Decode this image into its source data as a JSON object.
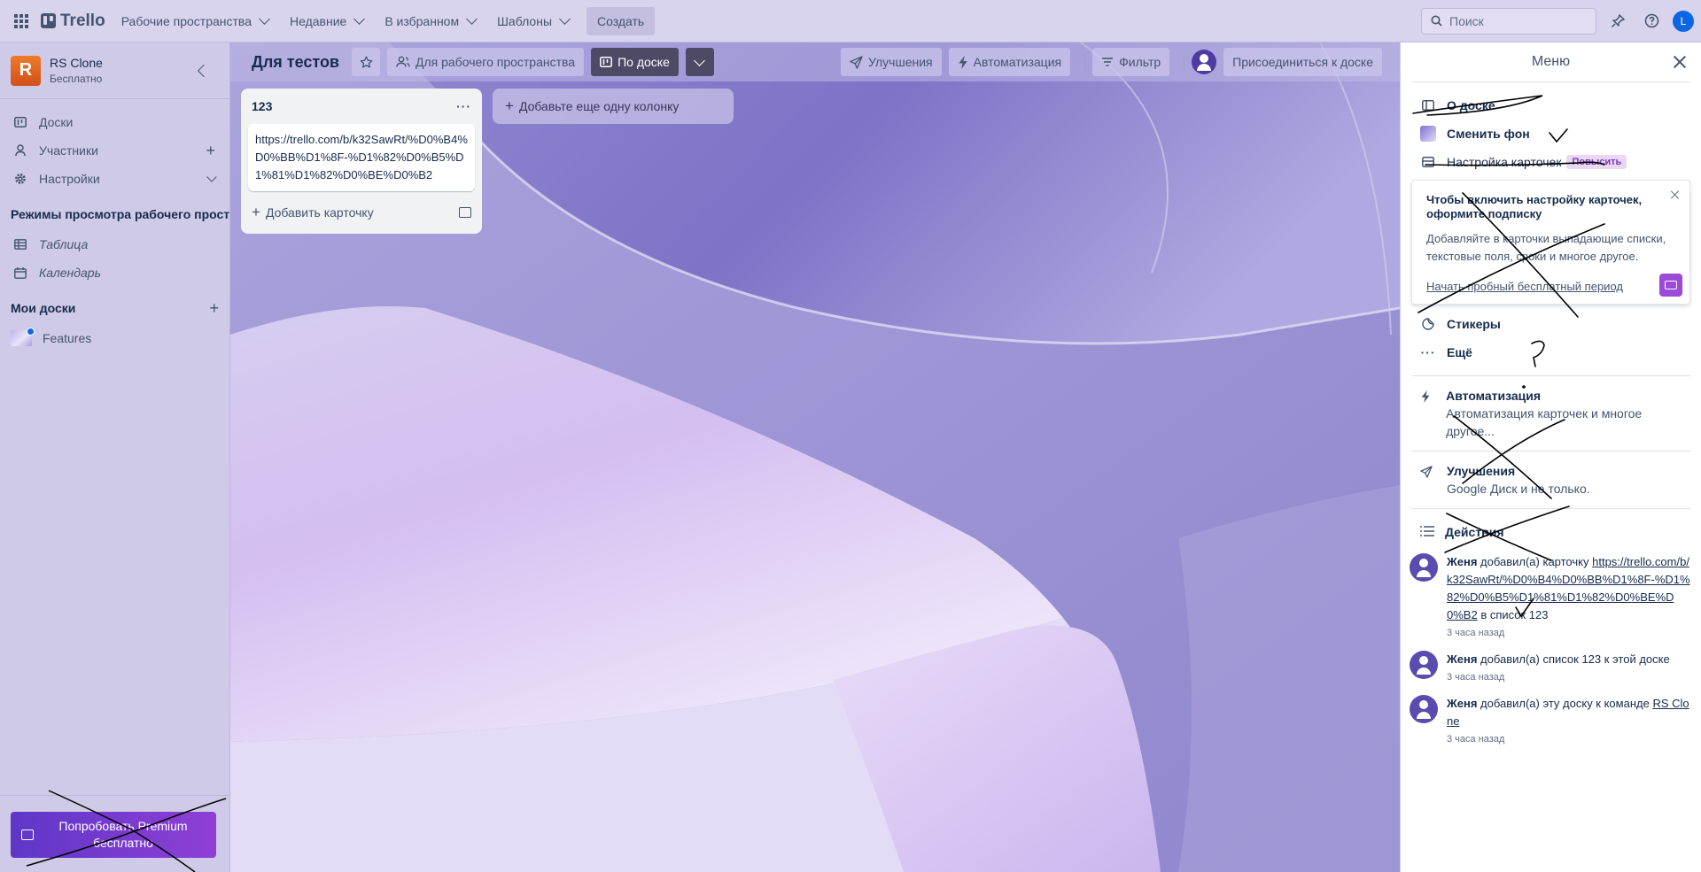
{
  "topbar": {
    "logo": "Trello",
    "nav": [
      {
        "label": "Рабочие пространства"
      },
      {
        "label": "Недавние"
      },
      {
        "label": "В избранном"
      },
      {
        "label": "Шаблоны"
      }
    ],
    "create": "Создать",
    "search_placeholder": "Поиск",
    "avatar_letter": "L"
  },
  "sidebar": {
    "workspace_letter": "R",
    "workspace_name": "RS Clone",
    "workspace_plan": "Бесплатно",
    "items": [
      {
        "label": "Доски"
      },
      {
        "label": "Участники"
      },
      {
        "label": "Настройки"
      }
    ],
    "views_header": "Режимы просмотра рабочего пространства",
    "views": [
      {
        "label": "Таблица"
      },
      {
        "label": "Календарь"
      }
    ],
    "my_boards_header": "Мои доски",
    "boards": [
      {
        "label": "Features"
      }
    ],
    "premium": "Попробовать Premium бесплатно"
  },
  "board": {
    "title": "Для тестов",
    "visibility": "Для рабочего пространства",
    "view": "По доске",
    "powerups": "Улучшения",
    "automation": "Автоматизация",
    "filter": "Фильтр",
    "join": "Присоединиться к доске",
    "lists": [
      {
        "title": "123",
        "cards": [
          {
            "text": "https://trello.com/b/k32SawRt/%D0%B4%D0%BB%D1%8F-%D1%82%D0%B5%D1%81%D1%82%D0%BE%D0%B2"
          }
        ],
        "add_card": "Добавить карточку"
      }
    ],
    "add_list": "Добавьте еще одну колонку"
  },
  "menu": {
    "title": "Меню",
    "about": "О доске",
    "change_bg": "Сменить фон",
    "card_settings": "Настройка карточек",
    "upgrade": "Повысить",
    "promo": {
      "title": "Чтобы включить настройку карточек, оформите подписку",
      "text": "Добавляйте в карточки выпадающие списки, текстовые поля, сроки и многое другое.",
      "link": "Начать пробный бесплатный период"
    },
    "stickers": "Стикеры",
    "more": "Ещё",
    "automation_title": "Автоматизация",
    "automation_desc": "Автоматизация карточек и многое другое...",
    "powerups_title": "Улучшения",
    "powerups_desc": "Google Диск и не только.",
    "activity_header": "Действия",
    "activity": [
      {
        "user": "Женя",
        "pre": " добавил(а) карточку ",
        "link": "https://trello.com/b/k32SawRt/%D0%B4%D0%BB%D1%8F-%D1%82%D0%B5%D1%81%D1%82%D0%BE%D0%B2",
        "post": " в список 123",
        "time": "3 часа назад"
      },
      {
        "user": "Женя",
        "pre": " добавил(а) список 123 к этой доске",
        "link": "",
        "post": "",
        "time": "3 часа назад"
      },
      {
        "user": "Женя",
        "pre": " добавил(а) эту доску к команде ",
        "link": "RS Clone",
        "post": "",
        "time": "3 часа назад"
      }
    ]
  },
  "colors": {
    "brand": "#0c66e4",
    "premium_gradient_start": "#5e37c7",
    "premium_gradient_end": "#8f3fd4",
    "board_bg": "#b9b3de"
  }
}
